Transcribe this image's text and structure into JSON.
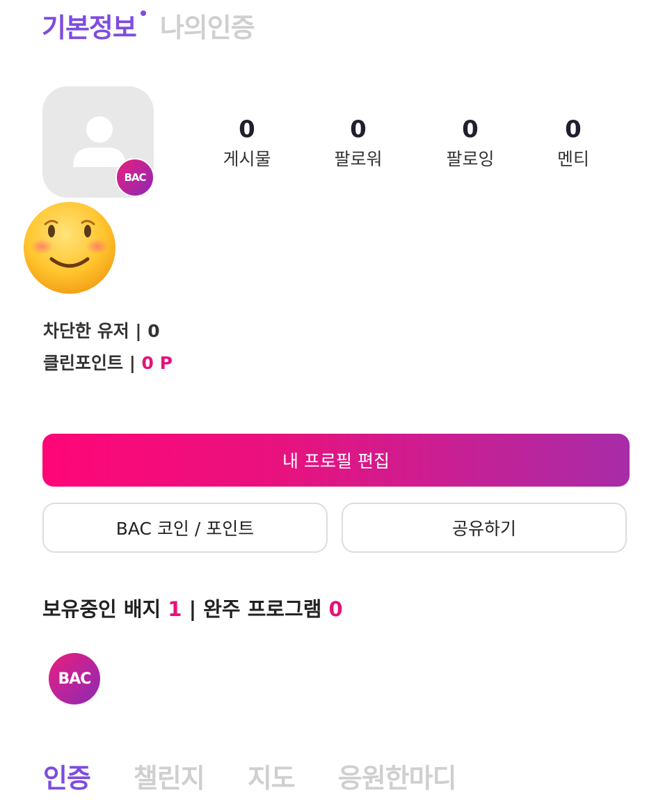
{
  "top_tabs": [
    {
      "label": "기본정보",
      "active": true
    },
    {
      "label": "나의인증",
      "active": false
    }
  ],
  "avatar": {
    "badge_text": "BAC",
    "emoji": "slightly-smiling-face-icon"
  },
  "stats": [
    {
      "value": "0",
      "label": "게시물"
    },
    {
      "value": "0",
      "label": "팔로워"
    },
    {
      "value": "0",
      "label": "팔로잉"
    },
    {
      "value": "0",
      "label": "멘티"
    }
  ],
  "blocked_users": {
    "label": "차단한 유저 | ",
    "value": "0"
  },
  "clean_points": {
    "label": "클린포인트 | ",
    "value": "0 P"
  },
  "buttons": {
    "edit_profile": "내 프로필 편집",
    "coin_point": "BAC 코인 / 포인트",
    "share": "공유하기"
  },
  "badges_summary": {
    "badges_label": "보유중인 배지 ",
    "badges_count": "1",
    "separator": " | 완주 프로그램 ",
    "programs_count": "0"
  },
  "badges": [
    {
      "text": "BAC"
    }
  ],
  "bottom_tabs": [
    {
      "label": "인증",
      "active": true
    },
    {
      "label": "챌린지",
      "active": false
    },
    {
      "label": "지도",
      "active": false
    },
    {
      "label": "응원한마디",
      "active": false
    }
  ],
  "colors": {
    "accent_purple": "#7d4ce0",
    "accent_pink": "#e4127a",
    "inactive": "#cfcfcf"
  }
}
